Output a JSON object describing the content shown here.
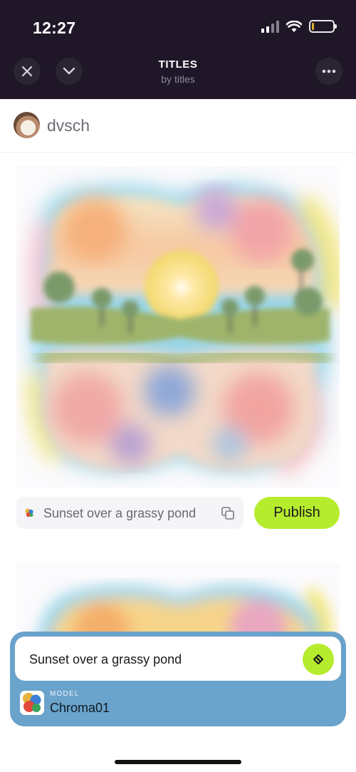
{
  "status": {
    "time": "12:27"
  },
  "nav": {
    "title": "TITLES",
    "subtitle": "by titles",
    "close_icon": "close-icon",
    "collapse_icon": "chevron-down-icon",
    "more_icon": "more-horizontal-icon"
  },
  "author": {
    "name": "dvsch"
  },
  "post": {
    "prompt": "Sunset over a grassy pond",
    "publish_label": "Publish",
    "copy_icon": "copy-icon"
  },
  "composer": {
    "input_value": "Sunset over a grassy pond",
    "model_caption": "MODEL",
    "model_name": "Chroma01",
    "send_icon": "generate-icon"
  },
  "colors": {
    "header_bg": "#1f1728",
    "accent": "#b6ec2e",
    "composer_bg": "#6aa3cb"
  }
}
